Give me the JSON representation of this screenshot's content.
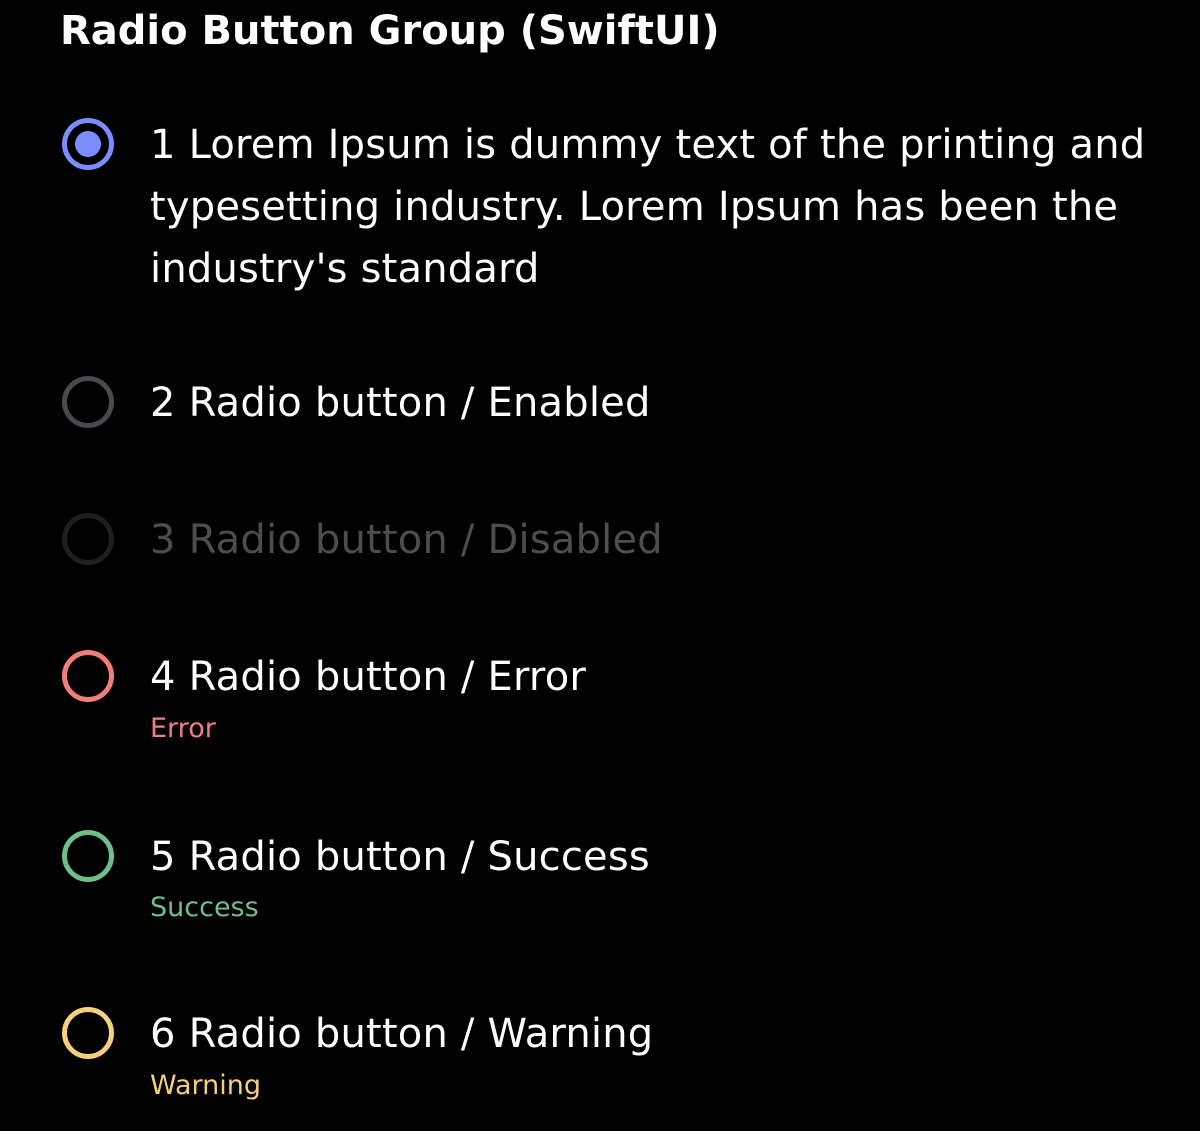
{
  "title": "Radio Button Group (SwiftUI)",
  "options": [
    {
      "label": "1 Lorem Ipsum is dummy text of the printing and typesetting industry. Lorem Ipsum has been the industry's standard",
      "state": "selected",
      "helper": "",
      "color": "#7b8cff"
    },
    {
      "label": "2 Radio button / Enabled",
      "state": "enabled",
      "helper": "",
      "color": "#4a4a4e"
    },
    {
      "label": "3 Radio button / Disabled",
      "state": "disabled",
      "helper": "",
      "color": "#1f1f21"
    },
    {
      "label": "4 Radio button / Error",
      "state": "error",
      "helper": "Error",
      "color": "#f07f7b"
    },
    {
      "label": "5 Radio button / Success",
      "state": "success",
      "helper": "Success",
      "color": "#6dbf8d"
    },
    {
      "label": "6 Radio button / Warning",
      "state": "warning",
      "helper": "Warning",
      "color": "#f5cf7a"
    }
  ],
  "colors": {
    "background": "#000000",
    "text": "#ffffff",
    "disabled_text": "#4d4d4d"
  }
}
